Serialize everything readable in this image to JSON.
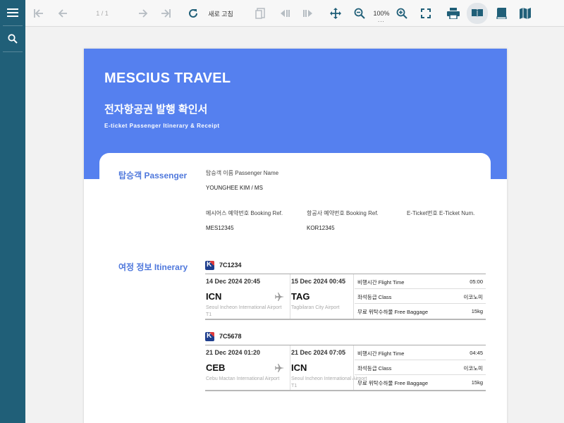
{
  "toolbar": {
    "page_indicator": "1 / 1",
    "refresh_label": "새로 고침",
    "zoom_level": "100%",
    "zoom_dots": "..."
  },
  "document": {
    "brand": "MESCIUS TRAVEL",
    "title_ko": "전자항공권 발행 확인서",
    "title_en": "E-ticket Passenger Itinerary & Receipt",
    "passenger": {
      "section_title": "탑승객 Passenger",
      "name_label": "탑승객 이름 Passenger Name",
      "name_value": "YOUNGHEE KIM / MS",
      "booking_label": "메시어스 예약번호 Booking Ref.",
      "booking_value": "MES12345",
      "airline_booking_label": "항공사 예약번호 Booking Ref.",
      "airline_booking_value": "KOR12345",
      "eticket_label": "E-Ticket번호 E-Ticket Num."
    },
    "itinerary": {
      "section_title": "여정 정보 Itinerary",
      "flights": [
        {
          "airline_logo_letter": "K",
          "flight_number": "7C1234",
          "depart_datetime": "14 Dec 2024 20:45",
          "arrive_datetime": "15 Dec 2024 00:45",
          "depart_code": "ICN",
          "arrive_code": "TAG",
          "depart_airport": "Seoul Incheon International Airport T1",
          "arrive_airport": "Tagbilaran City Airport",
          "flight_time_label": "비행시간 Flight Time",
          "flight_time": "05:00",
          "class_label": "좌석등급 Class",
          "class_value": "이코노미",
          "baggage_label": "무료 위탁수하물 Free Baggage",
          "baggage_value": "15kg"
        },
        {
          "airline_logo_letter": "K",
          "flight_number": "7C5678",
          "depart_datetime": "21 Dec 2024 01:20",
          "arrive_datetime": "21 Dec 2024 07:05",
          "depart_code": "CEB",
          "arrive_code": "ICN",
          "depart_airport": "Cebu Mactan International Airport",
          "arrive_airport": "Seoul Incheon International Airport T1",
          "flight_time_label": "비행시간 Flight Time",
          "flight_time": "04:45",
          "class_label": "좌석등급 Class",
          "class_value": "이코노미",
          "baggage_label": "무료 위탁수하물 Free Baggage",
          "baggage_value": "15kg"
        }
      ]
    }
  },
  "colors": {
    "rail": "#205f78",
    "hero": "#5580ef",
    "section_title": "#4f78dc",
    "icon": "#205f78"
  }
}
